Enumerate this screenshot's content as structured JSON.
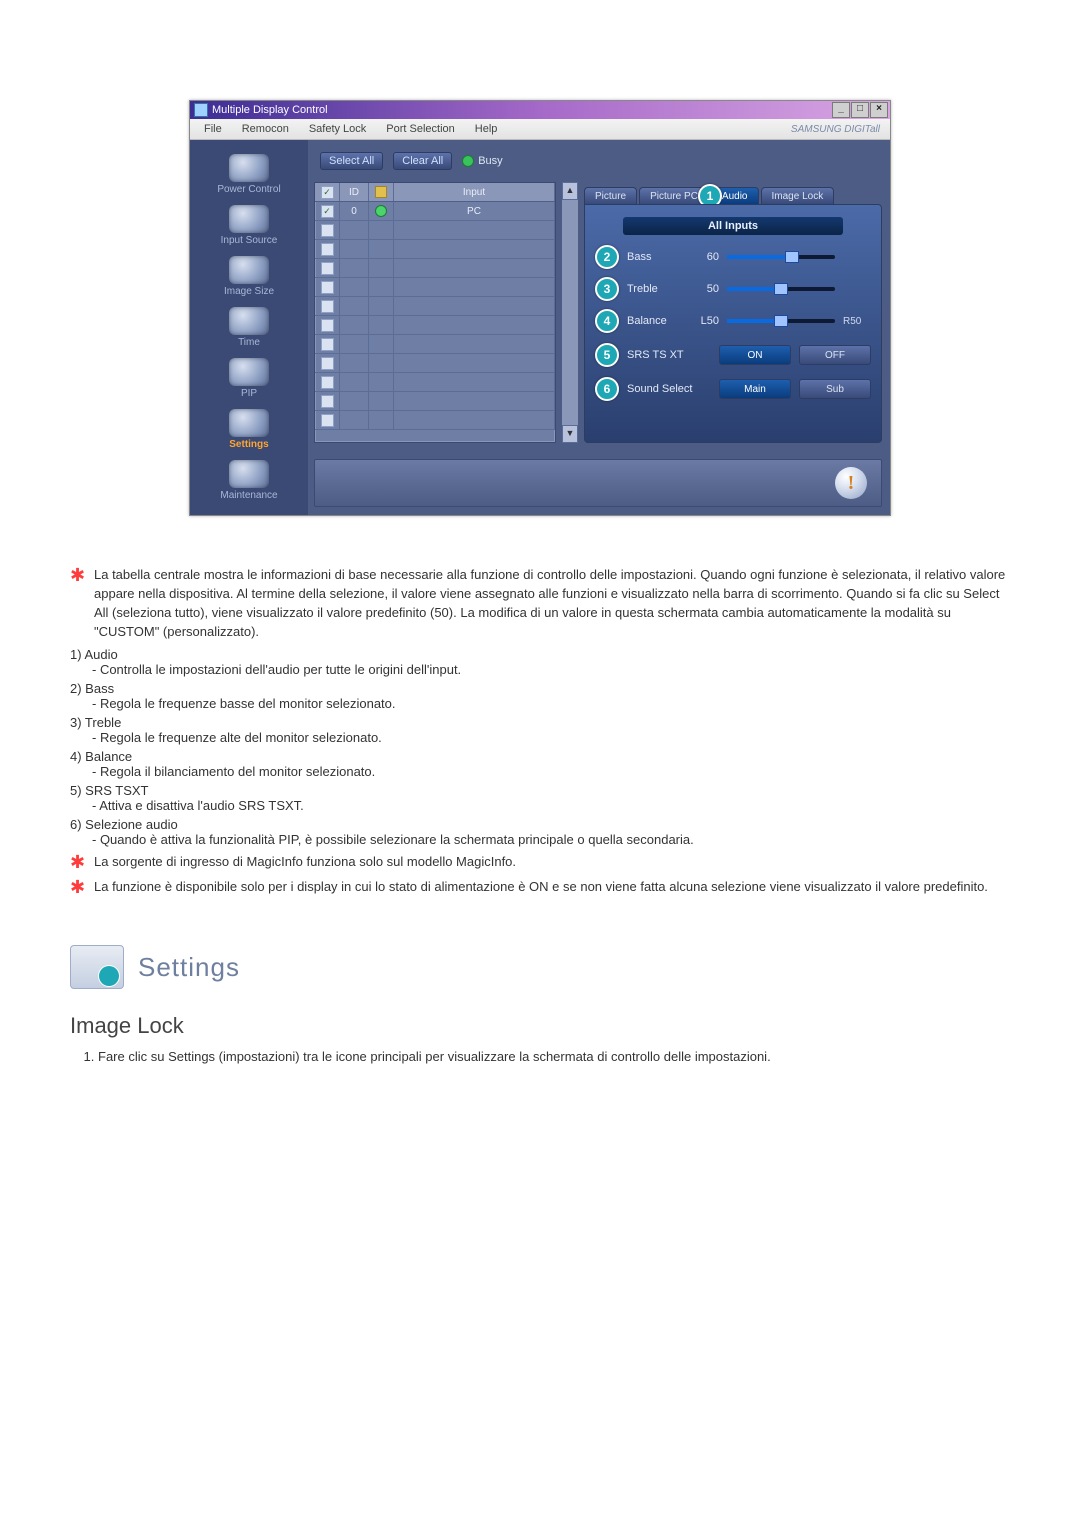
{
  "window": {
    "title": "Multiple Display Control",
    "menus": [
      "File",
      "Remocon",
      "Safety Lock",
      "Port Selection",
      "Help"
    ],
    "brand": "SAMSUNG DIGITall"
  },
  "sidebar": {
    "items": [
      {
        "label": "Power Control",
        "name": "sidebar-item-power-control"
      },
      {
        "label": "Input Source",
        "name": "sidebar-item-input-source"
      },
      {
        "label": "Image Size",
        "name": "sidebar-item-image-size"
      },
      {
        "label": "Time",
        "name": "sidebar-item-time"
      },
      {
        "label": "PIP",
        "name": "sidebar-item-pip"
      },
      {
        "label": "Settings",
        "name": "sidebar-item-settings",
        "active": true
      },
      {
        "label": "Maintenance",
        "name": "sidebar-item-maintenance"
      }
    ]
  },
  "toolbar": {
    "select_all": "Select All",
    "clear_all": "Clear All",
    "busy_label": "Busy"
  },
  "grid": {
    "headers": {
      "chk": "☑",
      "id": "ID",
      "status": "",
      "input": "Input"
    },
    "rows": [
      {
        "checked": true,
        "id": "0",
        "status": true,
        "input": "PC"
      },
      {
        "checked": false,
        "id": "",
        "status": false,
        "input": ""
      },
      {
        "checked": false,
        "id": "",
        "status": false,
        "input": ""
      },
      {
        "checked": false,
        "id": "",
        "status": false,
        "input": ""
      },
      {
        "checked": false,
        "id": "",
        "status": false,
        "input": ""
      },
      {
        "checked": false,
        "id": "",
        "status": false,
        "input": ""
      },
      {
        "checked": false,
        "id": "",
        "status": false,
        "input": ""
      },
      {
        "checked": false,
        "id": "",
        "status": false,
        "input": ""
      },
      {
        "checked": false,
        "id": "",
        "status": false,
        "input": ""
      },
      {
        "checked": false,
        "id": "",
        "status": false,
        "input": ""
      },
      {
        "checked": false,
        "id": "",
        "status": false,
        "input": ""
      },
      {
        "checked": false,
        "id": "",
        "status": false,
        "input": ""
      }
    ]
  },
  "tabs": {
    "items": [
      "Picture",
      "Picture PC",
      "Audio",
      "Image Lock"
    ],
    "active_index": 2,
    "callout_on_audio": "1"
  },
  "audio_panel": {
    "all_inputs": "All Inputs",
    "sliders": [
      {
        "num": "2",
        "label": "Bass",
        "value_text": "60",
        "percent": 60,
        "right": ""
      },
      {
        "num": "3",
        "label": "Treble",
        "value_text": "50",
        "percent": 50,
        "right": ""
      },
      {
        "num": "4",
        "label": "Balance",
        "value_text": "L50",
        "percent": 50,
        "right": "R50"
      }
    ],
    "button_rows": [
      {
        "num": "5",
        "label": "SRS TS XT",
        "options": [
          "ON",
          "OFF"
        ],
        "active_index": 0
      },
      {
        "num": "6",
        "label": "Sound Select",
        "options": [
          "Main",
          "Sub"
        ],
        "active_index": 0
      }
    ]
  },
  "doc": {
    "star_notes_top": "La tabella centrale mostra le informazioni di base necessarie alla funzione di controllo delle impostazioni. Quando ogni funzione è selezionata, il relativo valore appare nella dispositiva. Al termine della selezione, il valore viene assegnato alle funzioni e visualizzato nella barra di scorrimento. Quando si fa clic su Select All (seleziona tutto), viene visualizzato il valore predefinito (50). La modifica di un valore in questa schermata cambia automaticamente la modalità su \"CUSTOM\" (personalizzato).",
    "items": [
      {
        "n": "1)",
        "t": "Audio",
        "sub": "- Controlla le impostazioni dell'audio per tutte le origini dell'input."
      },
      {
        "n": "2)",
        "t": "Bass",
        "sub": "- Regola le frequenze basse del monitor selezionato."
      },
      {
        "n": "3)",
        "t": "Treble",
        "sub": "- Regola le frequenze alte del monitor selezionato."
      },
      {
        "n": "4)",
        "t": "Balance",
        "sub": "- Regola il bilanciamento del monitor selezionato."
      },
      {
        "n": "5)",
        "t": "SRS TSXT",
        "sub": "- Attiva e disattiva l'audio SRS TSXT."
      },
      {
        "n": "6)",
        "t": "Selezione audio",
        "sub": "- Quando è attiva la funzionalità PIP, è possibile selezionare la schermata principale o quella secondaria."
      }
    ],
    "star_notes_bottom": [
      "La sorgente di ingresso di MagicInfo funziona solo sul modello MagicInfo.",
      "La funzione è disponibile solo per i display in cui lo stato di alimentazione è ON e se non viene fatta alcuna selezione viene visualizzato il valore predefinito."
    ],
    "section_title": "Settings",
    "sub_title": "Image Lock",
    "ol_item": "Fare clic su Settings (impostazioni) tra le icone principali per visualizzare la schermata di controllo delle impostazioni."
  }
}
